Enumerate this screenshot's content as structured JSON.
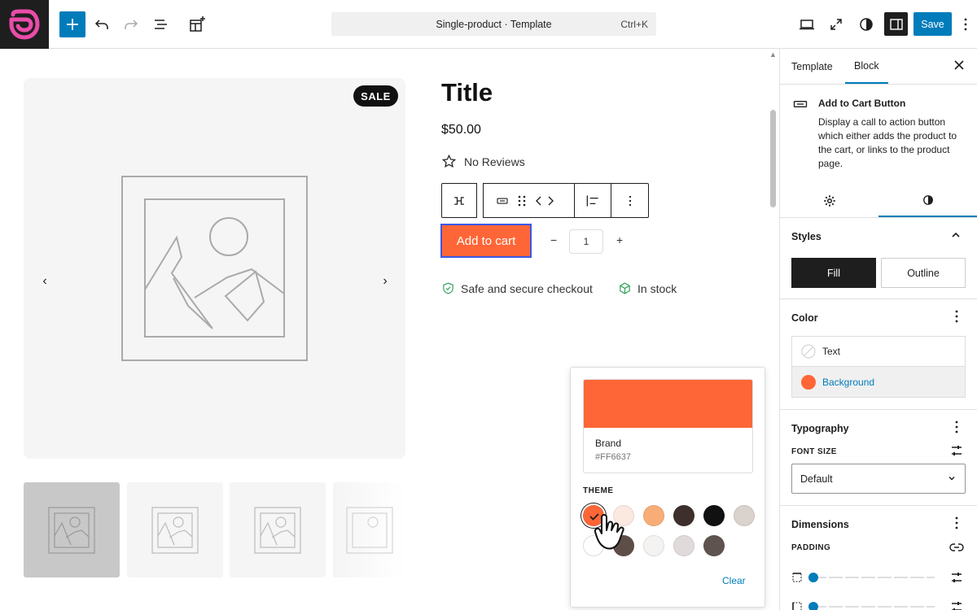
{
  "header": {
    "document_title": "Single-product · Template",
    "shortcut": "Ctrl+K",
    "save_label": "Save"
  },
  "product": {
    "sale_badge": "SALE",
    "title": "Title",
    "price": "$50.00",
    "reviews": "No Reviews",
    "add_to_cart_label": "Add to cart",
    "quantity": "1",
    "qty_minus": "−",
    "qty_plus": "+",
    "trust_secure": "Safe and secure checkout",
    "trust_stock": "In stock"
  },
  "color_popover": {
    "selected_name": "Brand",
    "selected_hex": "#FF6637",
    "theme_label": "THEME",
    "clear_label": "Clear",
    "theme_colors_row1": [
      "#ff6637",
      "#fbe9e0",
      "#f8ad78",
      "#3d302c",
      "#111111",
      "#d9d2cd"
    ],
    "theme_colors_row2": [
      "#ffffff",
      "#5e4e47",
      "#f4f3f2",
      "#e1dadb",
      "#5e534f"
    ]
  },
  "sidebar": {
    "tabs": [
      "Template",
      "Block"
    ],
    "active_tab": "Block",
    "block_name": "Add to Cart Button",
    "block_description": "Display a call to action button which either adds the product to the cart, or links to the product page.",
    "styles_title": "Styles",
    "style_fill": "Fill",
    "style_outline": "Outline",
    "color_title": "Color",
    "color_text": "Text",
    "color_background": "Background",
    "typography_title": "Typography",
    "font_size_label": "FONT SIZE",
    "font_size_value": "Default",
    "dimensions_title": "Dimensions",
    "padding_label": "PADDING"
  },
  "colors": {
    "accent": "#007cba",
    "brand": "#ff6637",
    "logo": "#e94ca9"
  }
}
